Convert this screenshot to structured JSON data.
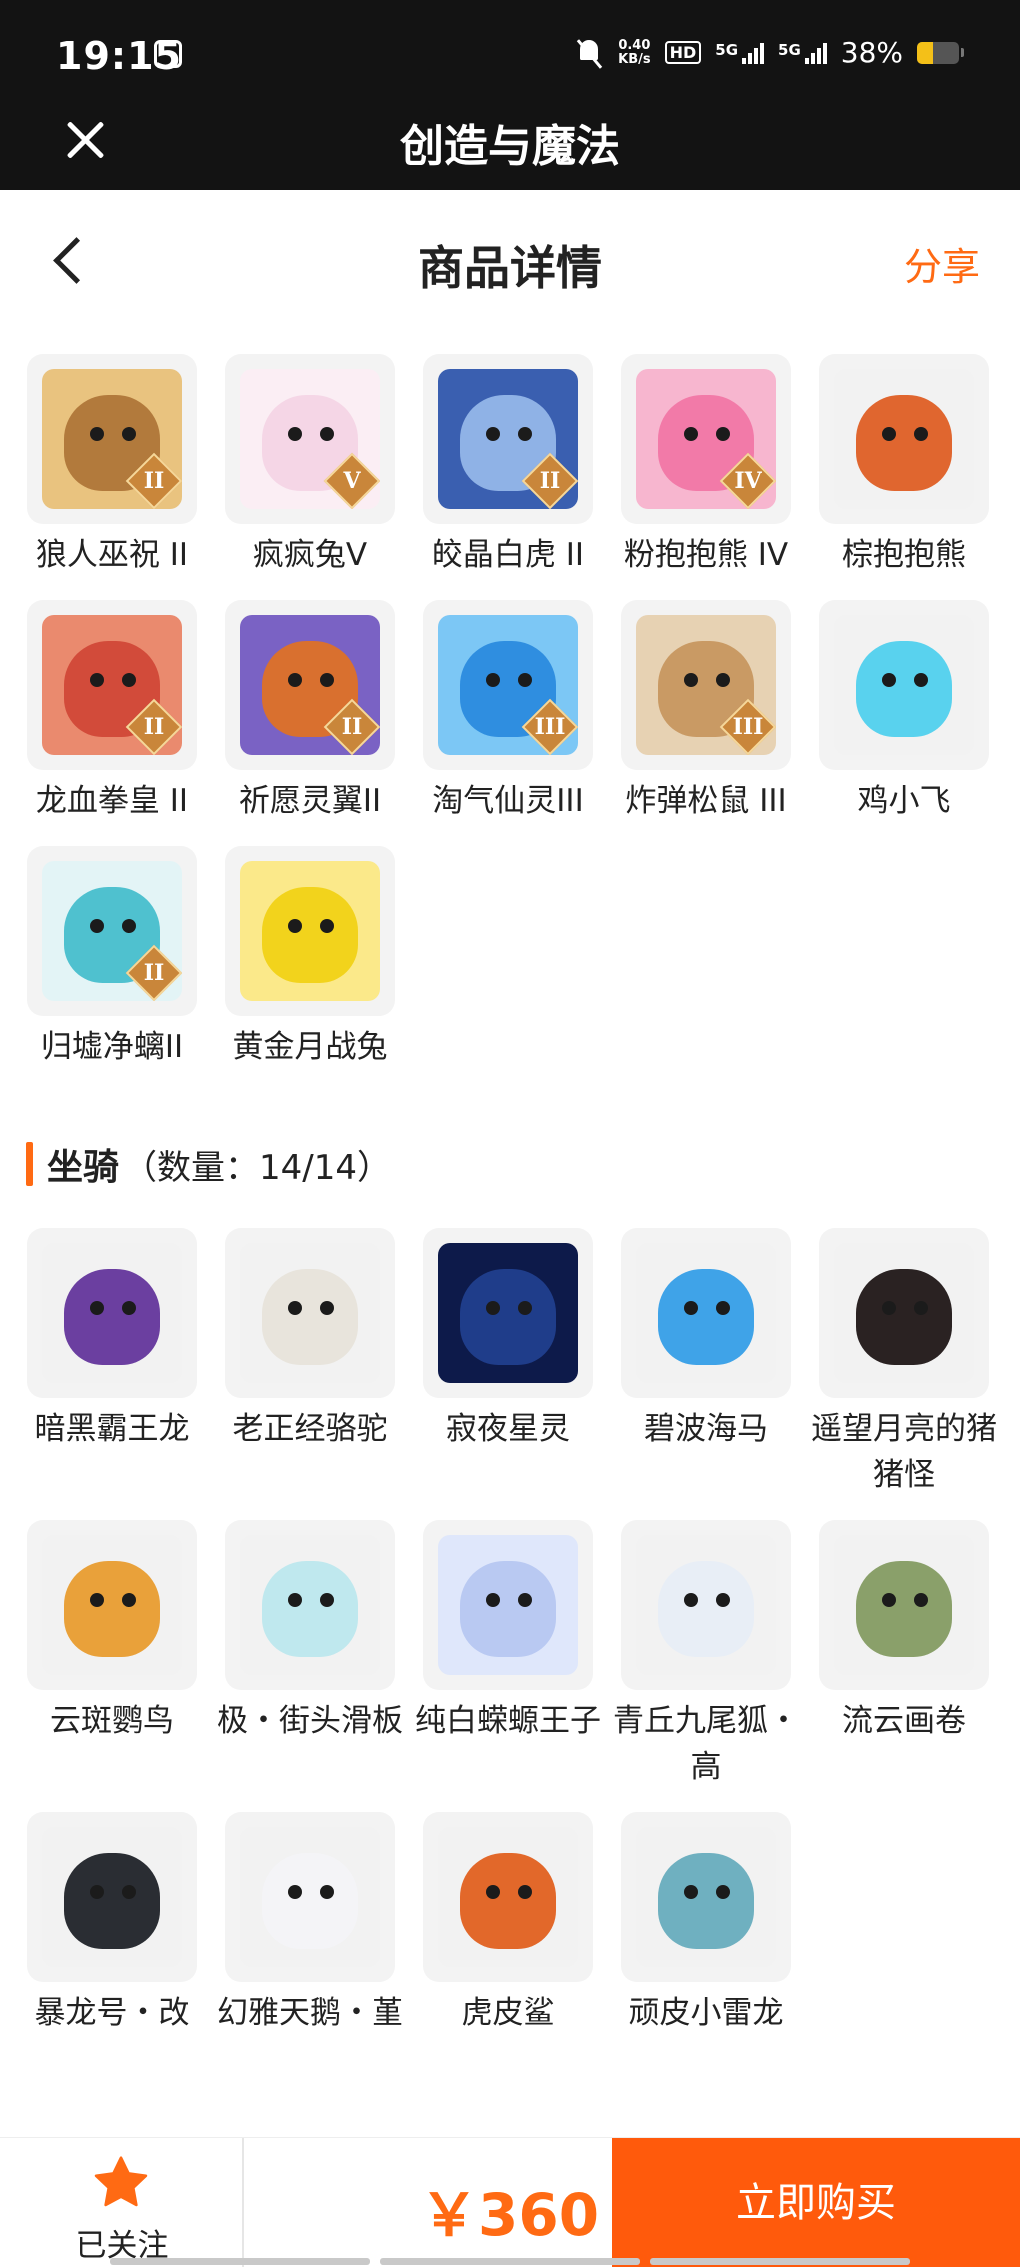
{
  "status_bar": {
    "time": "19:15",
    "net_speed_value": "0.40",
    "net_speed_unit": "KB/s",
    "hd_label": "HD",
    "signal_1_label": "5G",
    "signal_2_label": "5G",
    "battery_percent": "38%",
    "battery_level": 0.38,
    "battery_color": "#f4c018"
  },
  "app_bar": {
    "title": "创造与魔法"
  },
  "page_header": {
    "title": "商品详情",
    "share_label": "分享"
  },
  "colors": {
    "accent": "#ff6a13",
    "buy_button": "#ff5a0c"
  },
  "pets": [
    {
      "name": "狼人巫祝 II",
      "rank": "II",
      "art_color": "#b27a3c",
      "art_bg": "#e9c37f"
    },
    {
      "name": "疯疯兔V",
      "rank": "V",
      "art_color": "#f5d6e6",
      "art_bg": "#fbeef4"
    },
    {
      "name": "皎晶白虎 II",
      "rank": "II",
      "art_color": "#8fb2e6",
      "art_bg": "#3a5fb0"
    },
    {
      "name": "粉抱抱熊 IV",
      "rank": "IV",
      "art_color": "#f27aa8",
      "art_bg": "#f7b6cf"
    },
    {
      "name": "棕抱抱熊",
      "rank": "",
      "art_color": "#e0662f",
      "art_bg": "#f2f2f2"
    },
    {
      "name": "龙血拳皇 II",
      "rank": "II",
      "art_color": "#d24b3a",
      "art_bg": "#ea8a6e"
    },
    {
      "name": "祈愿灵翼II",
      "rank": "II",
      "art_color": "#d9702f",
      "art_bg": "#7a62c4"
    },
    {
      "name": "淘气仙灵III",
      "rank": "III",
      "art_color": "#2f8ee0",
      "art_bg": "#7cc7f5"
    },
    {
      "name": "炸弹松鼠 III",
      "rank": "III",
      "art_color": "#c99a64",
      "art_bg": "#e7d2b3"
    },
    {
      "name": "鸡小飞",
      "rank": "",
      "art_color": "#59d2ee",
      "art_bg": "#f2f2f2"
    },
    {
      "name": "归墟净螭II",
      "rank": "II",
      "art_color": "#4fc1cf",
      "art_bg": "#e3f4f6"
    },
    {
      "name": "黄金月战兔",
      "rank": "",
      "art_color": "#f2d31c",
      "art_bg": "#fbe98a"
    }
  ],
  "mounts_section": {
    "title": "坐骑",
    "count": "（数量：14/14）"
  },
  "mounts": [
    {
      "name": "暗黑霸王龙",
      "art_color": "#6b3fa0",
      "art_bg": "#f2f2f2"
    },
    {
      "name": "老正经骆驼",
      "art_color": "#e8e4dc",
      "art_bg": "#f2f2f2"
    },
    {
      "name": "寂夜星灵",
      "art_color": "#1f3d8a",
      "art_bg": "#0d1a4a"
    },
    {
      "name": "碧波海马",
      "art_color": "#3fa3e8",
      "art_bg": "#f2f2f2"
    },
    {
      "name": "遥望月亮的猪猪怪",
      "art_color": "#2a2222",
      "art_bg": "#f2f2f2"
    },
    {
      "name": "云斑鹦鸟",
      "art_color": "#e9a13a",
      "art_bg": "#f2f2f2"
    },
    {
      "name": "极・街头滑板",
      "art_color": "#bfe8ee",
      "art_bg": "#f2f2f2"
    },
    {
      "name": "纯白蝾螈王子",
      "art_color": "#b9c9f2",
      "art_bg": "#dfe7fb"
    },
    {
      "name": "青丘九尾狐・高",
      "art_color": "#e8eef6",
      "art_bg": "#f2f2f2"
    },
    {
      "name": "流云画卷",
      "art_color": "#8aa06a",
      "art_bg": "#f2f2f2"
    },
    {
      "name": "暴龙号・改",
      "art_color": "#2a2d33",
      "art_bg": "#f2f2f2"
    },
    {
      "name": "幻雅天鹅・堇",
      "art_color": "#f4f4f7",
      "art_bg": "#f2f2f2"
    },
    {
      "name": "虎皮鲨",
      "art_color": "#e2682a",
      "art_bg": "#f2f2f2"
    },
    {
      "name": "顽皮小雷龙",
      "art_color": "#6fb0c0",
      "art_bg": "#f2f2f2"
    }
  ],
  "bottom_bar": {
    "follow_label": "已关注",
    "price": "￥360",
    "buy_label": "立即购买"
  }
}
